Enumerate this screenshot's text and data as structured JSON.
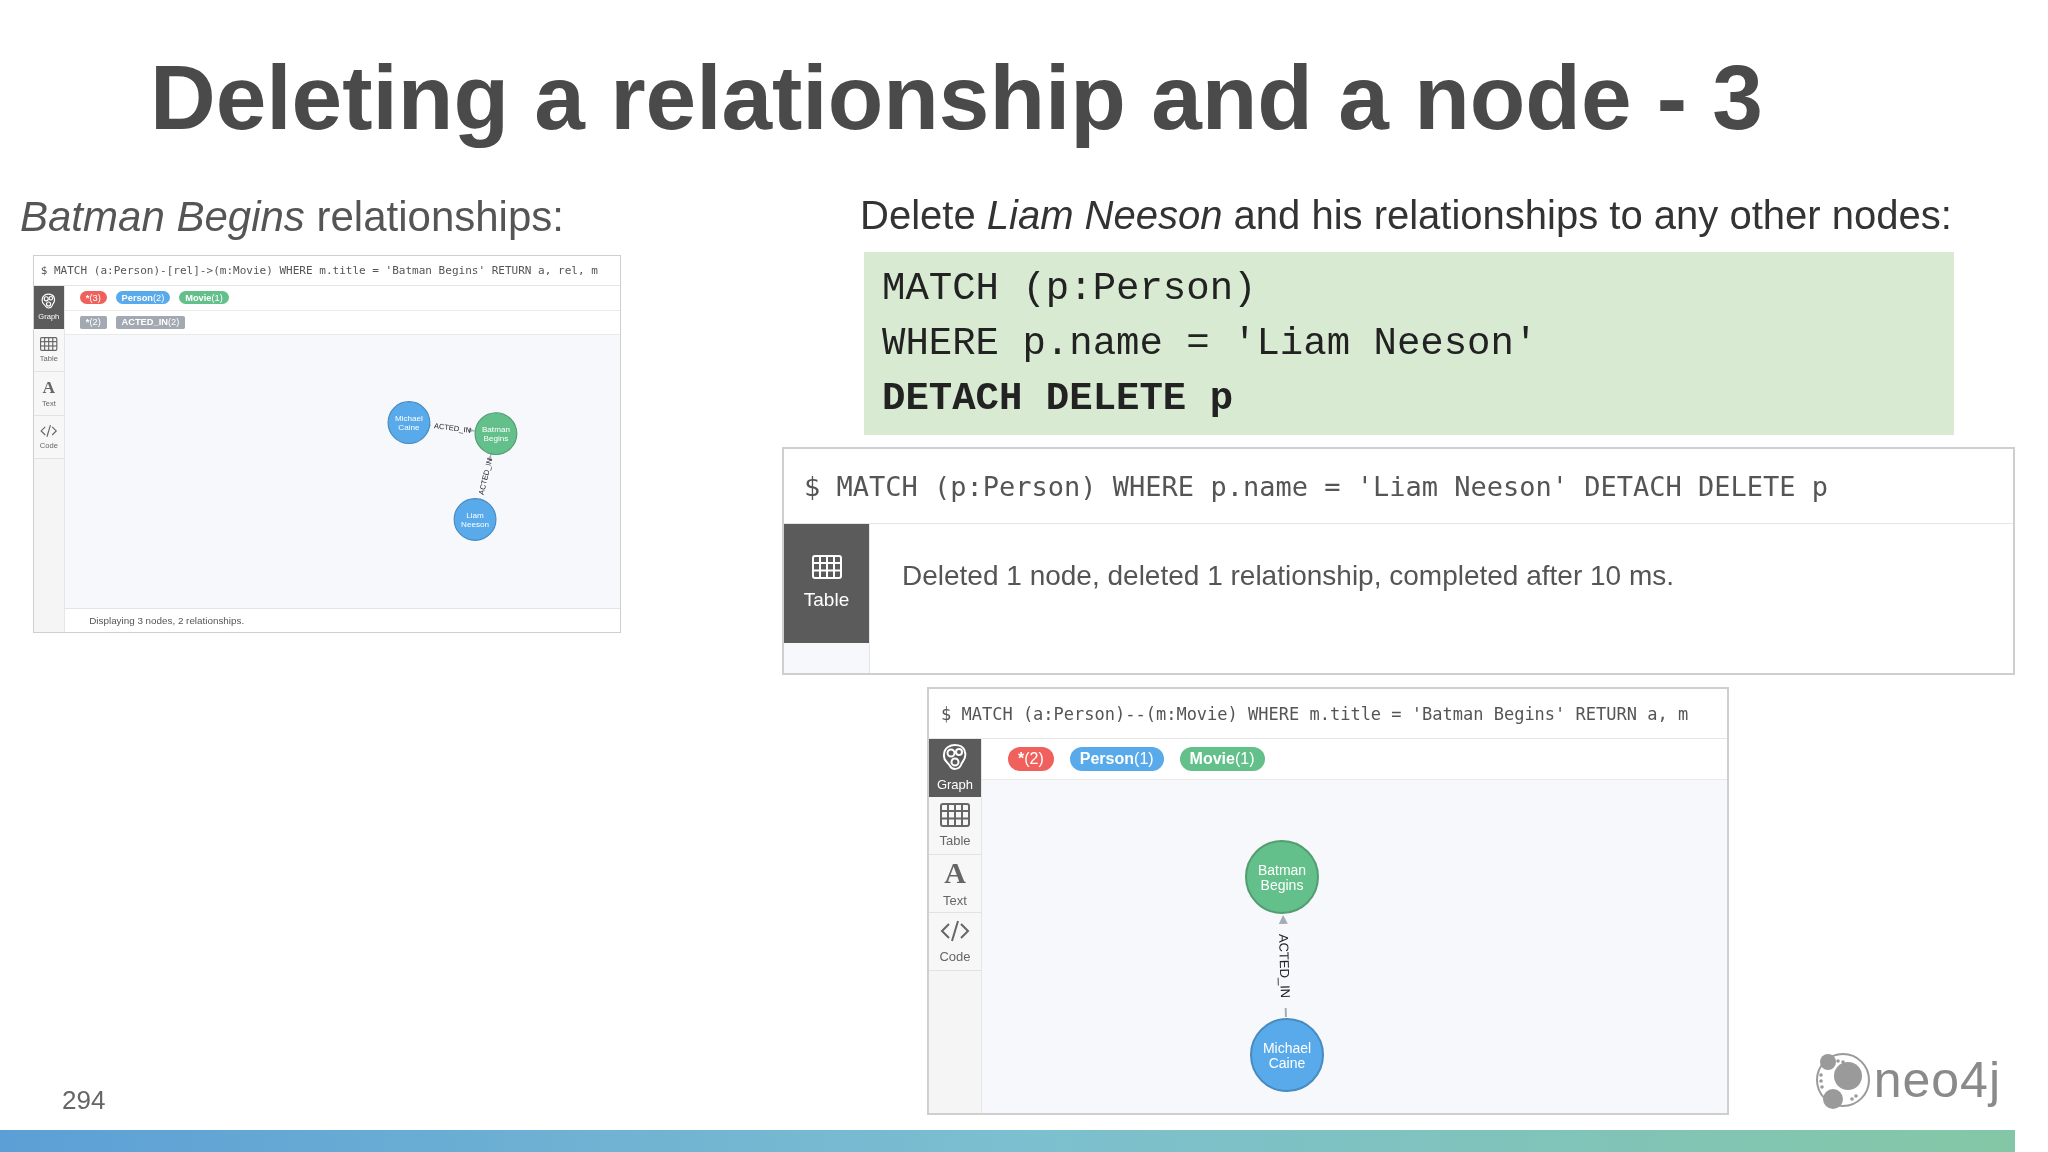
{
  "slide": {
    "title": "Deleting a relationship and a node - 3",
    "page_number": "294",
    "logo": "neo4j"
  },
  "left": {
    "caption": "*Batman Begins* relationships:",
    "browser": {
      "query": "$ MATCH (a:Person)-[rel]->(m:Movie) WHERE m.title = 'Batman Begins' RETURN a, rel, m",
      "sidebar": [
        {
          "kind": "graph",
          "label": "Graph",
          "selected": true
        },
        {
          "kind": "table",
          "label": "Table",
          "selected": false
        },
        {
          "kind": "text",
          "glyph": "A",
          "label": "Text",
          "selected": false
        },
        {
          "kind": "code",
          "label": "Code",
          "selected": false
        }
      ],
      "node_labels": [
        {
          "name": "*",
          "count": "(3)",
          "color": "#f0605d"
        },
        {
          "name": "Person",
          "count": "(2)",
          "color": "#58aaea"
        },
        {
          "name": "Movie",
          "count": "(1)",
          "color": "#64c08a"
        }
      ],
      "relationship_types": [
        {
          "name": "*",
          "count": "(2)"
        },
        {
          "name": "ACTED_IN",
          "count": "(2)"
        }
      ],
      "nodes": [
        {
          "caption": "Michael Caine",
          "color": "#58aaea"
        },
        {
          "caption": "Batman Begins",
          "color": "#64c08a"
        },
        {
          "caption": "Liam Neeson",
          "color": "#58aaea"
        }
      ],
      "relationships": [
        {
          "type": "ACTED_IN"
        },
        {
          "type": "ACTED_IN"
        }
      ],
      "status": "Displaying 3 nodes, 2 relationships."
    }
  },
  "right": {
    "caption": "Delete *Liam Neeson* and his relationships to any other nodes:",
    "code_lines": [
      {
        "text": "MATCH (p:Person)",
        "bold": false
      },
      {
        "text": "WHERE p.name = 'Liam Neeson'",
        "bold": false
      },
      {
        "text": "DETACH DELETE p",
        "bold": true
      }
    ],
    "result": {
      "query": "$ MATCH (p:Person) WHERE p.name = 'Liam Neeson' DETACH DELETE p",
      "sidebar": [
        {
          "kind": "table",
          "label": "Table",
          "selected": true
        }
      ],
      "message": "Deleted 1 node, deleted 1 relationship, completed after 10 ms."
    },
    "browser": {
      "query": "$ MATCH (a:Person)--(m:Movie) WHERE m.title = 'Batman Begins' RETURN a, m",
      "sidebar": [
        {
          "kind": "graph",
          "label": "Graph",
          "selected": true
        },
        {
          "kind": "table",
          "label": "Table",
          "selected": false
        },
        {
          "kind": "text",
          "glyph": "A",
          "label": "Text",
          "selected": false
        },
        {
          "kind": "code",
          "label": "Code",
          "selected": false
        }
      ],
      "node_labels": [
        {
          "name": "*",
          "count": "(2)",
          "color": "#f0605d"
        },
        {
          "name": "Person",
          "count": "(1)",
          "color": "#58aaea"
        },
        {
          "name": "Movie",
          "count": "(1)",
          "color": "#64c08a"
        }
      ],
      "nodes": [
        {
          "caption": "Batman Begins",
          "color": "#64c08a"
        },
        {
          "caption": "Michael Caine",
          "color": "#58aaea"
        }
      ],
      "relationships": [
        {
          "type": "ACTED_IN"
        }
      ]
    }
  }
}
